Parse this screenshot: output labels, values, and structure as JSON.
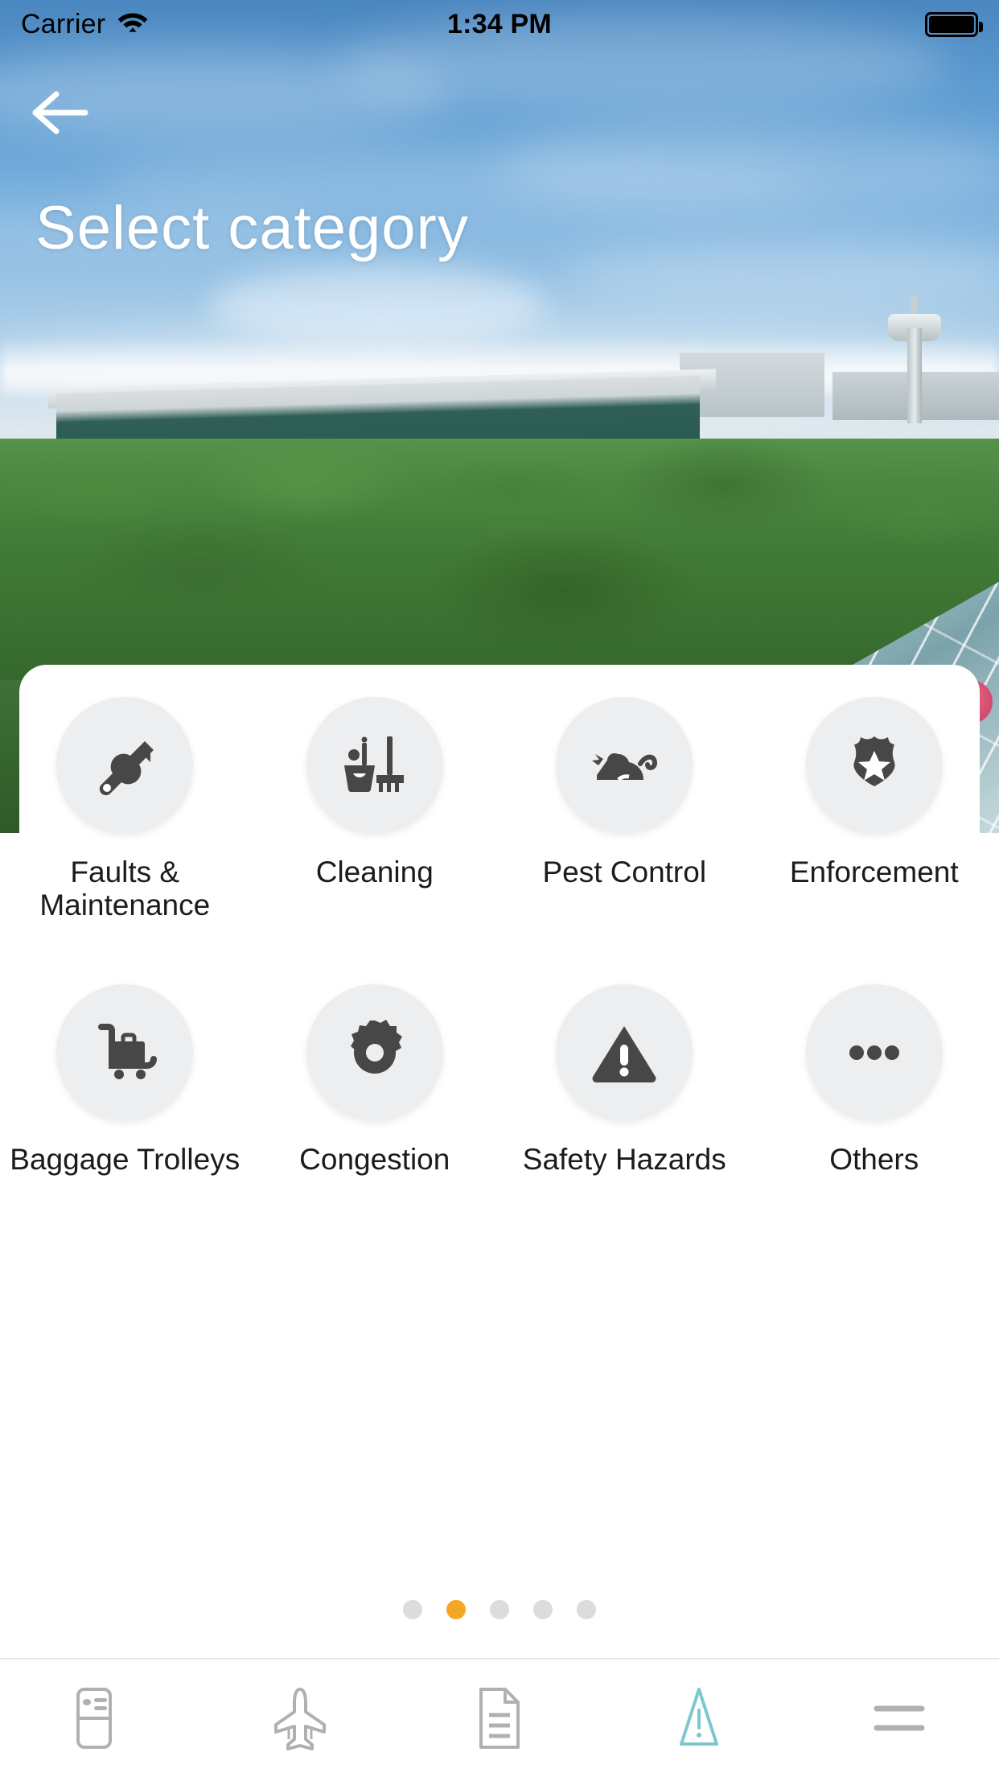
{
  "statusbar": {
    "carrier": "Carrier",
    "wifi_icon": "wifi-icon",
    "time": "1:34 PM",
    "battery_icon": "battery-full-icon"
  },
  "header": {
    "back_icon": "back-arrow-icon",
    "title": "Select category"
  },
  "categories": {
    "row1": [
      {
        "label": "Faults & Maintenance",
        "icon": "wrench-icon",
        "two_line": true
      },
      {
        "label": "Cleaning",
        "icon": "mop-bucket-icon",
        "two_line": false
      },
      {
        "label": "Pest Control",
        "icon": "rodent-icon",
        "two_line": false
      },
      {
        "label": "Enforcement",
        "icon": "police-badge-icon",
        "two_line": false
      }
    ],
    "row2": [
      {
        "label": "Baggage Trolleys",
        "icon": "luggage-trolley-icon",
        "two_line": false
      },
      {
        "label": "Congestion",
        "icon": "gear-icon",
        "two_line": false
      },
      {
        "label": "Safety Hazards",
        "icon": "warning-triangle-icon",
        "two_line": false
      },
      {
        "label": "Others",
        "icon": "ellipsis-icon",
        "two_line": false
      }
    ]
  },
  "pager": {
    "total": 5,
    "active_index": 1,
    "active_color": "#f5a623",
    "inactive_color": "#dcdcdc"
  },
  "bottom_nav": {
    "items": [
      {
        "icon": "id-card-icon",
        "active": false
      },
      {
        "icon": "airplane-icon",
        "active": false
      },
      {
        "icon": "document-icon",
        "active": false
      },
      {
        "icon": "warning-triangle-icon",
        "active": true
      },
      {
        "icon": "hamburger-menu-icon",
        "active": false
      }
    ],
    "active_color": "#7dc8ce",
    "inactive_color": "#b0b0b0"
  }
}
